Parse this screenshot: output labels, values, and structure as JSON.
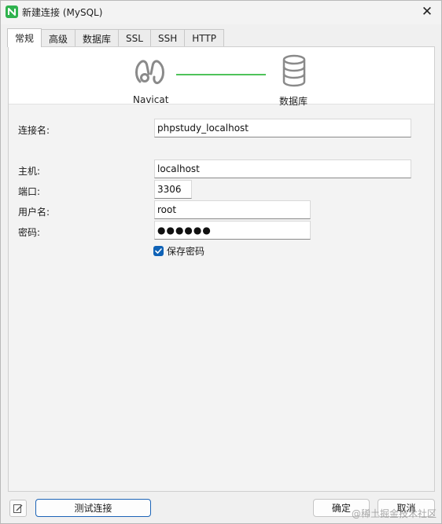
{
  "window": {
    "title": "新建连接 (MySQL)"
  },
  "tabs": [
    {
      "label": "常规",
      "active": true
    },
    {
      "label": "高级",
      "active": false
    },
    {
      "label": "数据库",
      "active": false
    },
    {
      "label": "SSL",
      "active": false
    },
    {
      "label": "SSH",
      "active": false
    },
    {
      "label": "HTTP",
      "active": false
    }
  ],
  "banner": {
    "left_label": "Navicat",
    "right_label": "数据库",
    "line_color": "#4fc35a",
    "left_icon": "navicat-logo-icon",
    "right_icon": "database-icon"
  },
  "form": {
    "connection_name": {
      "label": "连接名:",
      "value": "phpstudy_localhost"
    },
    "host": {
      "label": "主机:",
      "value": "localhost"
    },
    "port": {
      "label": "端口:",
      "value": "3306"
    },
    "username": {
      "label": "用户名:",
      "value": "root"
    },
    "password": {
      "label": "密码:",
      "value": "●●●●●●"
    },
    "save_password": {
      "label": "保存密码",
      "checked": true
    }
  },
  "footer": {
    "test_button": "测试连接",
    "ok_button": "确定",
    "cancel_button": "取消",
    "watermark": "@稀土掘金技术社区"
  },
  "colors": {
    "accent": "#0f62b6",
    "brand": "#2fb24e"
  }
}
